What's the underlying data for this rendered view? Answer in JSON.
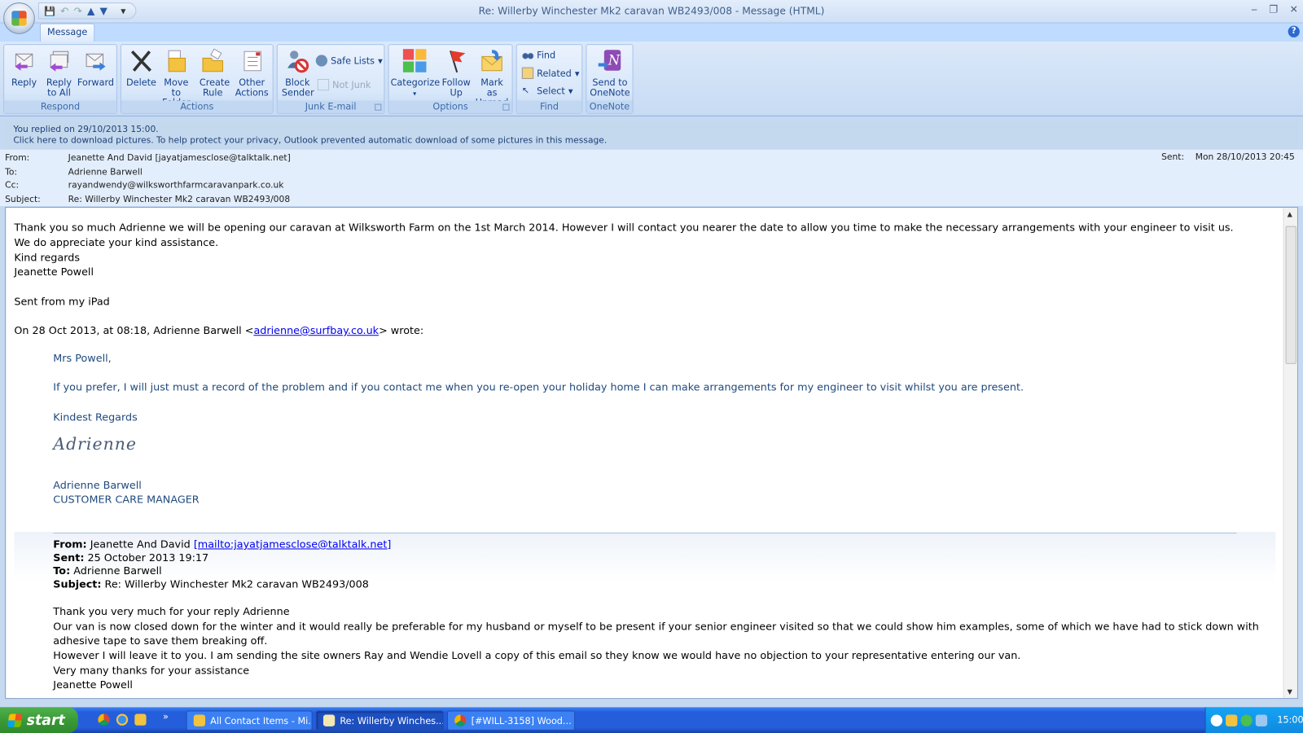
{
  "window": {
    "title": "Re: Willerby Winchester Mk2 caravan WB2493/008 - Message (HTML)",
    "minimize": "‒",
    "restore": "❐",
    "close": "✕",
    "help": "?"
  },
  "qat": {
    "save": "💾",
    "undo": "↶",
    "redo": "↷",
    "prev": "▲",
    "next": "▼",
    "customize": "▾"
  },
  "tabs": [
    {
      "label": "Message",
      "active": true
    }
  ],
  "ribbon": {
    "respond": {
      "label": "Respond",
      "reply": "Reply",
      "reply_all": "Reply to All",
      "forward": "Forward"
    },
    "actions": {
      "label": "Actions",
      "delete": "Delete",
      "move": "Move to Folder",
      "create_rule": "Create Rule",
      "other": "Other Actions"
    },
    "junk": {
      "label": "Junk E-mail",
      "block": "Block Sender",
      "safe_lists": "Safe Lists",
      "not_junk": "Not Junk"
    },
    "options": {
      "label": "Options",
      "categorize": "Categorize",
      "follow_up": "Follow Up",
      "mark_unread": "Mark as Unread"
    },
    "find": {
      "label": "Find",
      "find": "Find",
      "related": "Related",
      "select": "Select"
    },
    "onenote": {
      "label": "OneNote",
      "send": "Send to OneNote"
    }
  },
  "infobar": {
    "line1": "You replied on 29/10/2013 15:00.",
    "line2": "Click here to download pictures. To help protect your privacy, Outlook prevented automatic download of some pictures in this message."
  },
  "header": {
    "from_label": "From:",
    "from": "Jeanette And David [jayatjamesclose@talktalk.net]",
    "to_label": "To:",
    "to": "Adrienne Barwell",
    "cc_label": "Cc:",
    "cc": "rayandwendy@wilksworthfarmcaravanpark.co.uk",
    "subject_label": "Subject:",
    "subject": "Re: Willerby Winchester Mk2 caravan WB2493/008",
    "sent_label": "Sent:",
    "sent": "Mon 28/10/2013 20:45"
  },
  "body": {
    "l1": "Thank you so much Adrienne we will be opening our caravan at Wilksworth Farm on the 1st March 2014.  However I will contact you nearer the date to allow you time to make the necessary arrangements with your engineer to visit us.",
    "l2": "We do appreciate your kind assistance.",
    "l3": "Kind regards",
    "l4": "Jeanette Powell",
    "l5": "Sent from my iPad",
    "wrote_pre": "On 28 Oct 2013, at 08:18, Adrienne Barwell <",
    "wrote_link": "adrienne@surfbay.co.uk",
    "wrote_post": "> wrote:",
    "r1": "Mrs Powell,",
    "r2": "If you prefer, I will just must a record of the problem and if you contact me when you re-open your holiday home I can make arrangements for my engineer to visit whilst you are present.",
    "r3": "Kindest Regards",
    "signature": "Adrienne",
    "r4": "Adrienne Barwell",
    "r5": "CUSTOMER CARE MANAGER",
    "q_from_label": "From:",
    "q_from": " Jeanette And David ",
    "q_from_link": "[mailto:jayatjamesclose@talktalk.net]",
    "q_sent_label": "Sent:",
    "q_sent": " 25 October 2013 19:17",
    "q_to_label": "To:",
    "q_to": " Adrienne Barwell",
    "q_subject_label": "Subject:",
    "q_subject": " Re: Willerby Winchester Mk2 caravan WB2493/008",
    "q1": "Thank you very much for your reply Adrienne",
    "q2": "Our van is now closed down for the winter and it would really be preferable for my husband or myself to be present if your senior engineer visited so that we could show him examples, some of which we have had to stick down with",
    "q3": "adhesive tape to save them breaking off.",
    "q4": "However I will leave it to you.  I am sending the site owners Ray and Wendie Lovell a copy of this email so they know we would have no objection to your representative entering our van.",
    "q5": "Very many thanks for your assistance",
    "q6": "Jeanette Powell"
  },
  "taskbar": {
    "start": "start",
    "more": "»",
    "tasks": [
      "All Contact Items - Mi...",
      "Re: Willerby Winches...",
      "[#WILL-3158] Wood..."
    ],
    "clock": "15:00"
  }
}
